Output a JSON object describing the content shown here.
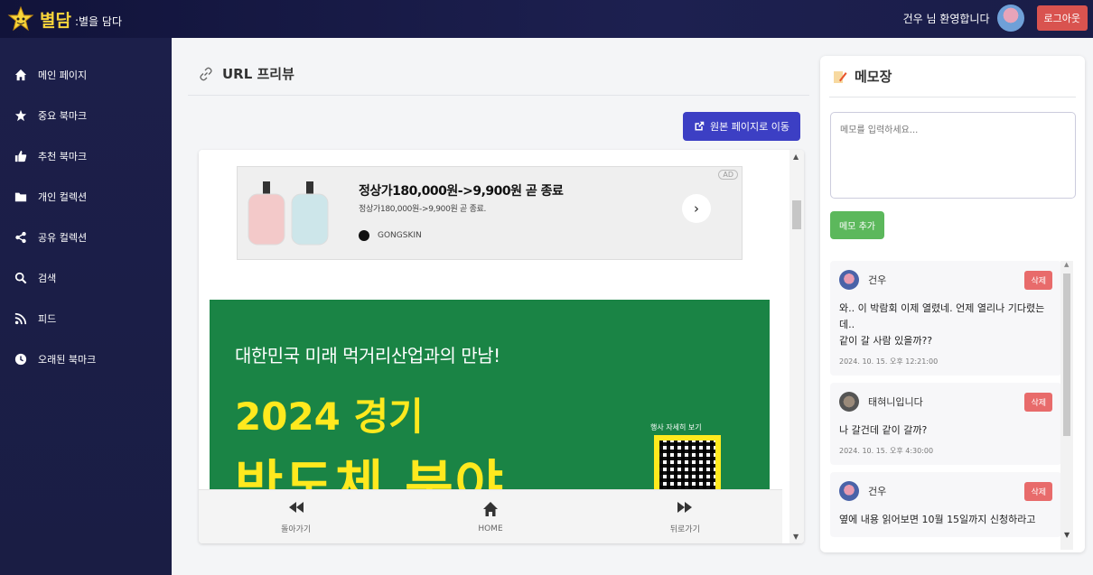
{
  "header": {
    "brand": "별담",
    "brand_sub": ":별을 담다",
    "welcome": "건우 님 환영합니다",
    "logout_label": "로그아웃"
  },
  "sidebar": {
    "items": [
      {
        "label": "메인 페이지",
        "icon": "home-icon"
      },
      {
        "label": "중요 북마크",
        "icon": "star-icon"
      },
      {
        "label": "추천 북마크",
        "icon": "thumbs-up-icon"
      },
      {
        "label": "개인 컬렉션",
        "icon": "folder-icon"
      },
      {
        "label": "공유 컬렉션",
        "icon": "share-icon"
      },
      {
        "label": "검색",
        "icon": "search-icon"
      },
      {
        "label": "피드",
        "icon": "rss-icon"
      },
      {
        "label": "오래된 북마크",
        "icon": "clock-icon"
      }
    ]
  },
  "main": {
    "title": "URL 프리뷰",
    "original_button": "원본 페이지로 이동",
    "ad": {
      "badge": "AD",
      "headline": "정상가180,000원->9,900원 곧 종료",
      "description": "정상가180,000원->9,900원 곧 종료.",
      "brand": "GONGSKIN"
    },
    "banner": {
      "line1": "대한민국 미래 먹거리산업과의 만남!",
      "line2": "2024 경기",
      "line3": "반도체 분야",
      "qr_label": "행사 자세히 보기"
    },
    "bottom_nav": {
      "back": "돌아가기",
      "home": "HOME",
      "forward": "뒤로가기"
    }
  },
  "memo": {
    "title": "메모장",
    "placeholder": "메모를 입력하세요...",
    "add_label": "메모 추가",
    "items": [
      {
        "name": "건우",
        "delete": "삭제",
        "text": "와.. 이 박람회 이제 열렸네. 언제 열리나 기다렸는데..\n같이 갈 사람 있을까??",
        "time": "2024. 10. 15. 오후 12:21:00"
      },
      {
        "name": "태혀니입니다",
        "delete": "삭제",
        "text": "나 갈건데 같이 갈까?",
        "time": "2024. 10. 15. 오후 4:30:00"
      },
      {
        "name": "건우",
        "delete": "삭제",
        "text": "옆에 내용 읽어보면 10월 15일까지 신청하라고",
        "time": ""
      }
    ]
  },
  "colors": {
    "sidebar_bg": "#1c1f4a",
    "accent_blue": "#3c3fc4",
    "danger": "#d9534f",
    "success": "#5cb85c",
    "brand_yellow": "#f8d53b"
  }
}
